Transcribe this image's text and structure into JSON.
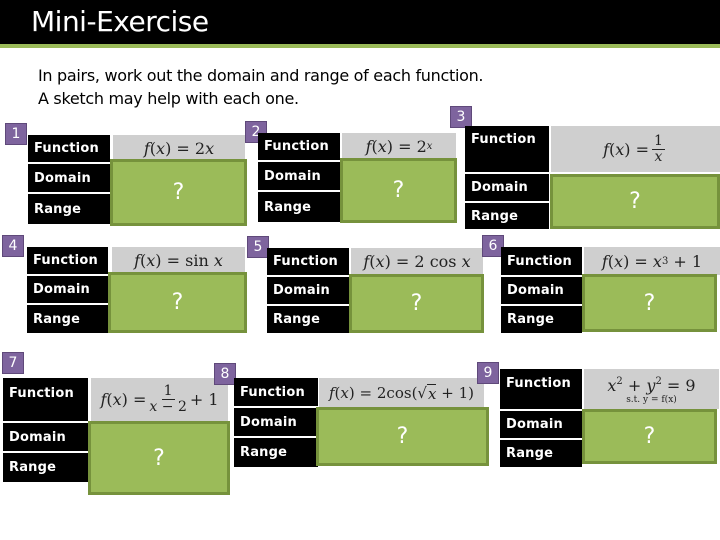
{
  "header": {
    "title": "Mini-Exercise"
  },
  "instructions": {
    "line1": "In pairs, work out the domain and range of each function.",
    "line2": "A sketch may help with each one."
  },
  "labels": {
    "function": "Function",
    "domain": "Domain",
    "range": "Range"
  },
  "colors": {
    "badge": "#7e649e",
    "answer_box": "#9bbb59",
    "answer_border": "#76923c",
    "formula_box": "#cfcfcf",
    "title_bar": "#000000",
    "accent_line": "#9bbb59"
  },
  "exercises": [
    {
      "number": "1",
      "formula_text": "f(x) = 2x",
      "answer_placeholder": "?"
    },
    {
      "number": "2",
      "formula_text": "f(x) = 2^x",
      "answer_placeholder": "?"
    },
    {
      "number": "3",
      "formula_text": "f(x) = 1/x",
      "answer_placeholder": "?"
    },
    {
      "number": "4",
      "formula_text": "f(x) = sin x",
      "answer_placeholder": "?"
    },
    {
      "number": "5",
      "formula_text": "f(x) = 2 cos x",
      "answer_placeholder": "?"
    },
    {
      "number": "6",
      "formula_text": "f(x) = x^3 + 1",
      "answer_placeholder": "?"
    },
    {
      "number": "7",
      "formula_text": "f(x) = 1/(x-2) + 1",
      "answer_placeholder": "?"
    },
    {
      "number": "8",
      "formula_text": "f(x) = 2cos(sqrt(x) + 1)",
      "answer_placeholder": "?"
    },
    {
      "number": "9",
      "formula_text": "x^2 + y^2 = 9",
      "formula_subtext": "s.t. y = f(x)",
      "answer_placeholder": "?"
    }
  ],
  "math": {
    "f": "f",
    "x": "x",
    "y": "y",
    "eq": "=",
    "lp": "(",
    "rp": ")",
    "one": "1",
    "two": "2",
    "three": "3",
    "nine": "9",
    "plus": "+",
    "minus": "−",
    "sin": "sin",
    "cos": "cos",
    "sqrt": "√",
    "st": "s.t."
  }
}
